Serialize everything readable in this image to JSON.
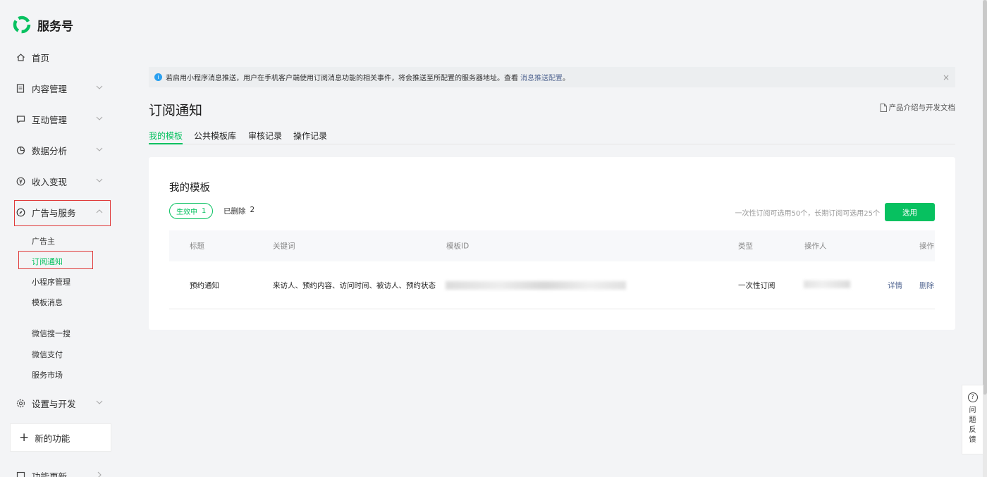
{
  "brand": {
    "name": "服务号"
  },
  "sidebar": {
    "home": "首页",
    "content_mgmt": "内容管理",
    "interaction_mgmt": "互动管理",
    "data_analysis": "数据分析",
    "monetize": "收入变现",
    "ads_services": "广告与服务",
    "sub_items": [
      "广告主",
      "订阅通知",
      "小程序管理",
      "模板消息",
      "微信搜一搜",
      "微信支付",
      "服务市场"
    ],
    "settings_dev": "设置与开发",
    "new_feature": "新的功能",
    "feature_update": "功能更新"
  },
  "notice": {
    "text": "若启用小程序消息推送，用户在手机客户端使用订阅消息功能的相关事件，将会推送至所配置的服务器地址。查看",
    "link": "消息推送配置",
    "suffix": "。",
    "close": "×"
  },
  "page": {
    "title": "订阅通知",
    "doc_link": "产品介绍与开发文档"
  },
  "tabs": [
    "我的模板",
    "公共模板库",
    "审核记录",
    "操作记录"
  ],
  "card": {
    "title": "我的模板",
    "active_label": "生效中",
    "active_count": "1",
    "deleted_label": "已删除",
    "deleted_count": "2",
    "limit_text": "一次性订阅可选用50个，长期订阅可选用25个",
    "select_button": "选用"
  },
  "table": {
    "headers": [
      "标题",
      "关键词",
      "模板ID",
      "类型",
      "操作人",
      "操作"
    ],
    "rows": [
      {
        "title": "预约通知",
        "keywords": "来访人、预约内容、访问时间、被访人、预约状态",
        "type": "一次性订阅",
        "detail": "详情",
        "delete": "删除"
      }
    ]
  },
  "feedback": {
    "label": "问题反馈",
    "q": "?"
  },
  "colors": {
    "accent": "#07c160",
    "link": "#576b95",
    "highlight": "#e03a3a"
  }
}
